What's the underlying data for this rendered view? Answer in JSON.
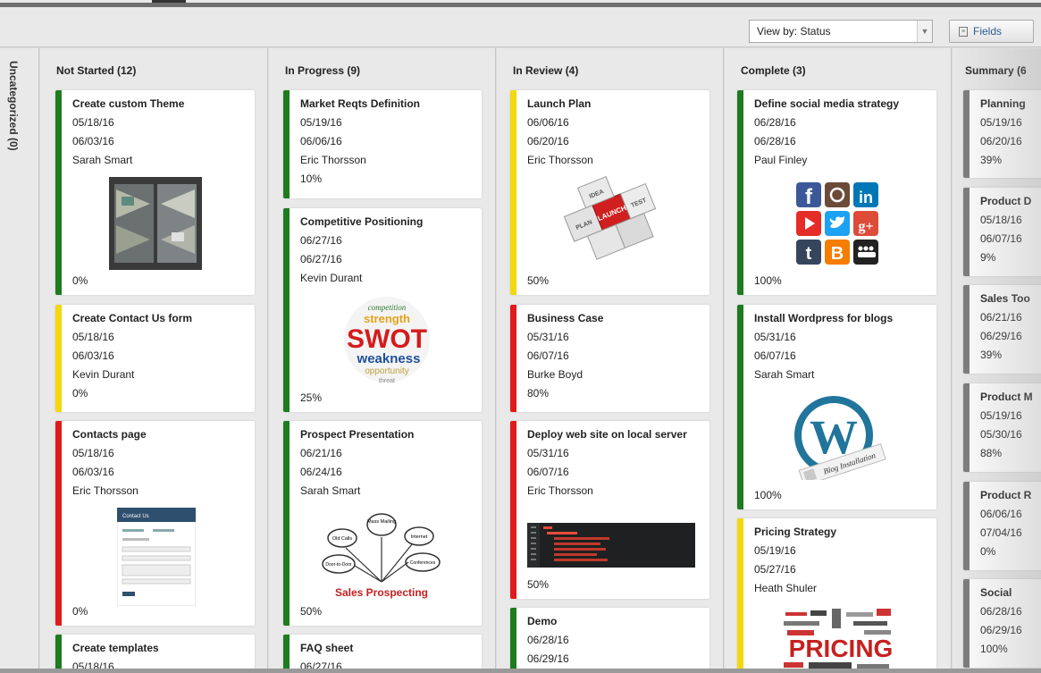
{
  "toolbar": {
    "view_by": "View by: Status",
    "fields_label": "Fields",
    "fields_icon": "list-icon"
  },
  "uncategorized": "Uncategorized (0)",
  "colors": {
    "green": "#1e7b1e",
    "yellow": "#f2d80c",
    "red": "#e01b1b",
    "gray": "#7a7a7a"
  },
  "columns": [
    {
      "title": "Not Started (12)",
      "cards": [
        {
          "title": "Create custom Theme",
          "start": "05/18/16",
          "end": "06/03/16",
          "owner": "Sarah Smart",
          "pct": "0%"
        },
        {
          "title": "Create Contact Us form",
          "start": "05/18/16",
          "end": "06/03/16",
          "owner": "Kevin Durant",
          "pct": "0%"
        },
        {
          "title": "Contacts page",
          "start": "05/18/16",
          "end": "06/03/16",
          "owner": "Eric Thorsson",
          "pct": "0%",
          "image_text": "Contact Us"
        },
        {
          "title": "Create templates",
          "start": "05/18/16"
        }
      ]
    },
    {
      "title": "In Progress (9)",
      "cards": [
        {
          "title": "Market Reqts Definition",
          "start": "05/19/16",
          "end": "06/06/16",
          "owner": "Eric Thorsson",
          "pct": "10%"
        },
        {
          "title": "Competitive Positioning",
          "start": "06/27/16",
          "end": "06/27/16",
          "owner": "Kevin Durant",
          "pct": "25%",
          "image_words": [
            "competition",
            "strength",
            "SWOT",
            "weakness",
            "opportunity",
            "threat"
          ]
        },
        {
          "title": "Prospect Presentation",
          "start": "06/21/16",
          "end": "06/24/16",
          "owner": "Sarah Smart",
          "pct": "50%",
          "image_words": [
            "Mass Mailing",
            "Old Calls",
            "Internet",
            "Conferences",
            "Door-to-Door",
            "Sales Prospecting"
          ]
        },
        {
          "title": "FAQ sheet",
          "start": "06/27/16"
        }
      ]
    },
    {
      "title": "In Review (4)",
      "cards": [
        {
          "title": "Launch Plan",
          "start": "06/06/16",
          "end": "06/20/16",
          "owner": "Eric Thorsson",
          "pct": "50%",
          "image_words": [
            "LAUNCH",
            "PLAN",
            "TEST",
            "IDEA"
          ]
        },
        {
          "title": "Business Case",
          "start": "05/31/16",
          "end": "06/07/16",
          "owner": "Burke Boyd",
          "pct": "80%"
        },
        {
          "title": "Deploy web site on local server",
          "start": "05/31/16",
          "end": "06/07/16",
          "owner": "Eric Thorsson",
          "pct": "50%"
        },
        {
          "title": "Demo",
          "start": "06/28/16",
          "end": "06/29/16"
        }
      ]
    },
    {
      "title": "Complete (3)",
      "cards": [
        {
          "title": "Define social media strategy",
          "start": "06/28/16",
          "end": "06/28/16",
          "owner": "Paul Finley",
          "pct": "100%"
        },
        {
          "title": "Install Wordpress for blogs",
          "start": "05/31/16",
          "end": "06/07/16",
          "owner": "Sarah Smart",
          "pct": "100%",
          "image_text": "Blog Installation"
        },
        {
          "title": "Pricing Strategy",
          "start": "05/19/16",
          "end": "05/27/16",
          "owner": "Heath Shuler",
          "image_text": "PRICING"
        }
      ]
    },
    {
      "title": "Summary (6",
      "cards": [
        {
          "title": "Planning",
          "start": "05/19/16",
          "end": "06/20/16",
          "pct": "39%"
        },
        {
          "title": "Product D",
          "start": "05/18/16",
          "end": "06/07/16",
          "pct": "9%"
        },
        {
          "title": "Sales Too",
          "start": "06/21/16",
          "end": "06/29/16",
          "pct": "39%"
        },
        {
          "title": "Product M",
          "start": "05/19/16",
          "end": "05/30/16",
          "pct": "88%"
        },
        {
          "title": "Product R",
          "start": "06/06/16",
          "end": "07/04/16",
          "pct": "0%"
        },
        {
          "title": "Social",
          "start": "06/28/16",
          "end": "06/29/16",
          "pct": "100%"
        }
      ]
    }
  ]
}
